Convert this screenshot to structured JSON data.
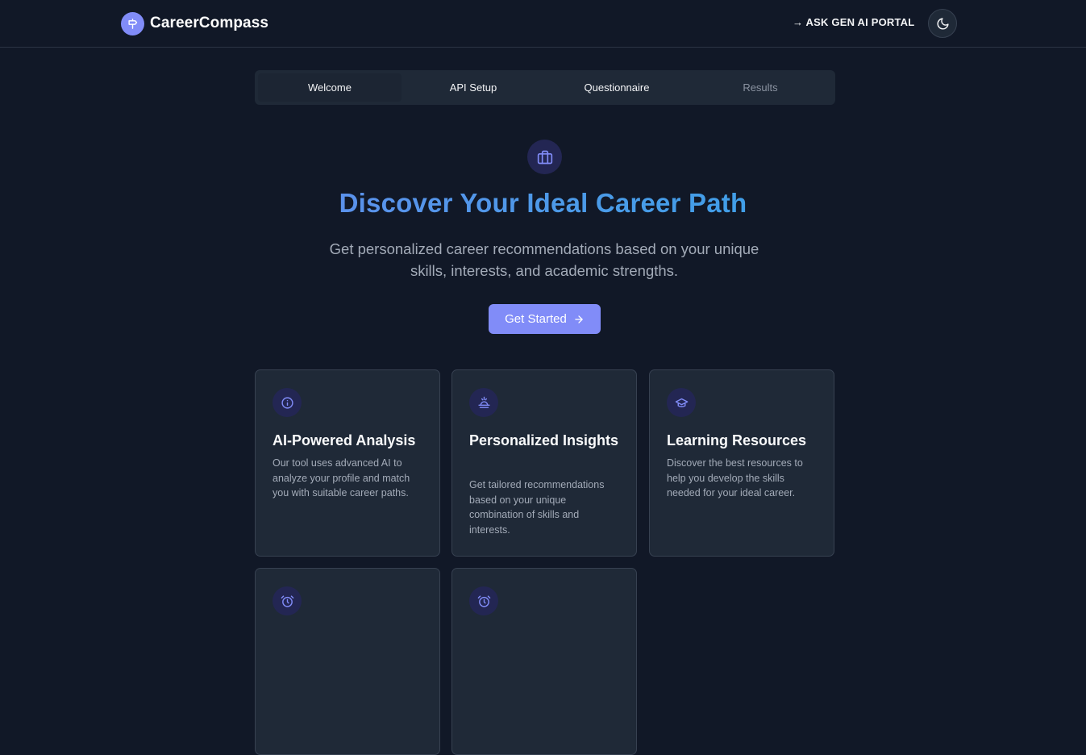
{
  "header": {
    "brand_name": "CareerCompass",
    "portal_link": "→ ASK GEN AI PORTAL"
  },
  "tabs": [
    {
      "label": "Welcome",
      "state": "active"
    },
    {
      "label": "API Setup",
      "state": "enabled"
    },
    {
      "label": "Questionnaire",
      "state": "enabled"
    },
    {
      "label": "Results",
      "state": "disabled"
    }
  ],
  "hero": {
    "title": "Discover Your Ideal Career Path",
    "subtitle": "Get personalized career recommendations based on your unique skills, interests, and academic strengths.",
    "cta_label": "Get Started"
  },
  "features": [
    {
      "title": "AI-Powered Analysis",
      "description": "Our tool uses advanced AI to analyze your profile and match you with suitable career paths.",
      "icon": "info-icon"
    },
    {
      "title": "Personalized Insights",
      "description": "Get tailored recommendations based on your unique combination of skills and interests.",
      "icon": "sunrise-icon"
    },
    {
      "title": "Learning Resources",
      "description": "Discover the best resources to help you develop the skills needed for your ideal career.",
      "icon": "graduation-cap-icon"
    },
    {
      "title": "",
      "description": "",
      "icon": "alarm-clock-icon"
    },
    {
      "title": "",
      "description": "",
      "icon": "alarm-clock-icon"
    }
  ],
  "colors": {
    "background": "#111827",
    "card": "#1f2937",
    "accent": "#818cf8",
    "title_gradient_start": "#7186f0",
    "title_gradient_end": "#2ca4e6"
  }
}
